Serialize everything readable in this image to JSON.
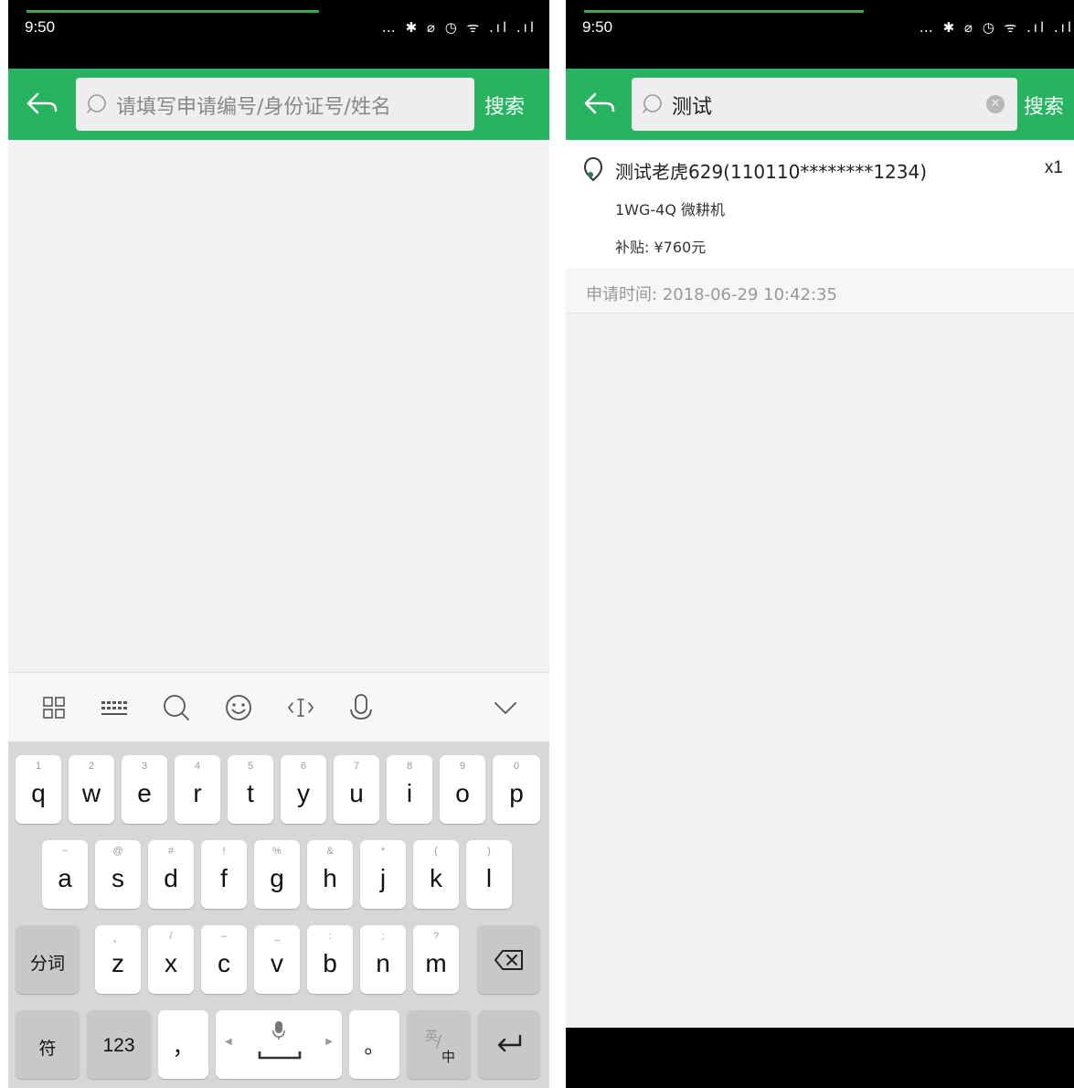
{
  "left": {
    "status": {
      "time": "9:50",
      "icons": "… ✱ ⌀ ◷ ᯤ .ıl .ıl"
    },
    "search": {
      "placeholder": "请填写申请编号/身份证号/姓名",
      "button": "搜索"
    },
    "keyboard": {
      "row1": [
        {
          "sub": "1",
          "main": "q"
        },
        {
          "sub": "2",
          "main": "w"
        },
        {
          "sub": "3",
          "main": "e"
        },
        {
          "sub": "4",
          "main": "r"
        },
        {
          "sub": "5",
          "main": "t"
        },
        {
          "sub": "6",
          "main": "y"
        },
        {
          "sub": "7",
          "main": "u"
        },
        {
          "sub": "8",
          "main": "i"
        },
        {
          "sub": "9",
          "main": "o"
        },
        {
          "sub": "0",
          "main": "p"
        }
      ],
      "row2": [
        {
          "sub": "~",
          "main": "a"
        },
        {
          "sub": "@",
          "main": "s"
        },
        {
          "sub": "#",
          "main": "d"
        },
        {
          "sub": "!",
          "main": "f"
        },
        {
          "sub": "%",
          "main": "g"
        },
        {
          "sub": "&",
          "main": "h"
        },
        {
          "sub": "*",
          "main": "j"
        },
        {
          "sub": "(",
          "main": "k"
        },
        {
          "sub": ")",
          "main": "l"
        }
      ],
      "row3": [
        {
          "sub": "、",
          "main": "z"
        },
        {
          "sub": "/",
          "main": "x"
        },
        {
          "sub": "–",
          "main": "c"
        },
        {
          "sub": "_",
          "main": "v"
        },
        {
          "sub": ":",
          "main": "b"
        },
        {
          "sub": ";",
          "main": "n"
        },
        {
          "sub": "?",
          "main": "m"
        }
      ],
      "fenci": "分词",
      "fu": "符",
      "num": "123",
      "comma": "，",
      "period": "。",
      "lang_top": "英",
      "lang_bottom": "中"
    }
  },
  "right": {
    "status": {
      "time": "9:50",
      "icons": "… ✱ ⌀ ◷ ᯤ .ıl .ıl"
    },
    "search": {
      "value": "测试",
      "button": "搜索"
    },
    "result": {
      "title": "测试老虎629(110110********1234)",
      "qty": "x1",
      "model": "1WG-4Q 微耕机",
      "subsidy": "补贴: ¥760元",
      "apply_time": "申请时间: 2018-06-29 10:42:35"
    }
  },
  "colors": {
    "brand_green": "#27b360",
    "progress_green": "#27b24a"
  }
}
